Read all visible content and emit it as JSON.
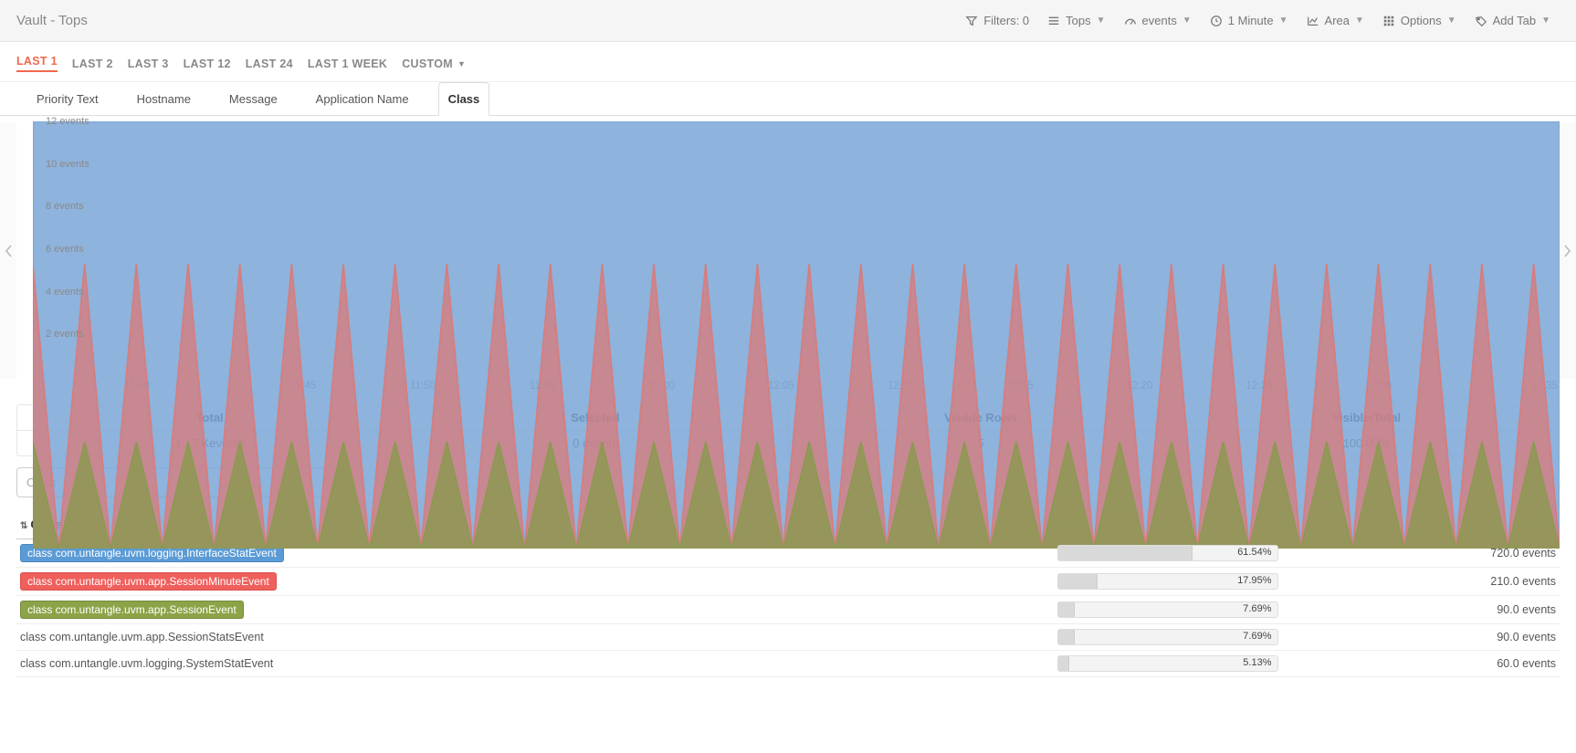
{
  "header": {
    "title": "Vault - Tops",
    "toolbar": {
      "filters": "Filters: 0",
      "tops": "Tops",
      "events": "events",
      "interval": "1 Minute",
      "chartType": "Area",
      "options": "Options",
      "addTab": "Add Tab"
    }
  },
  "ranges": {
    "items": [
      "LAST 1",
      "LAST 2",
      "LAST 3",
      "LAST 12",
      "LAST 24",
      "LAST 1 WEEK"
    ],
    "custom": "CUSTOM",
    "activeIndex": 0
  },
  "subtabs": {
    "items": [
      "Priority Text",
      "Hostname",
      "Message",
      "Application Name",
      "Class"
    ],
    "activeIndex": 4
  },
  "chart": {
    "yTicks": [
      "12 events",
      "10 events",
      "8 events",
      "6 events",
      "4 events",
      "2 events"
    ],
    "xTicks": [
      "11:40",
      "11:45",
      "11:50",
      "11:55",
      "12:00",
      "12:05",
      "12:10",
      "12:15",
      "12:20",
      "12:25",
      "12:30",
      "12:35"
    ]
  },
  "chart_data": {
    "type": "area",
    "title": "",
    "xlabel": "",
    "ylabel": "events",
    "ylim": [
      0,
      12
    ],
    "x_tick_labels": [
      "11:40",
      "11:45",
      "11:50",
      "11:55",
      "12:00",
      "12:05",
      "12:10",
      "12:15",
      "12:20",
      "12:25",
      "12:30",
      "12:35"
    ],
    "note": "Stacked area. Every minute the total reaches 12 and alternates with lower values; middle and bottom layers oscillate 0↔5 and 0↔3 respectively, producing the zig-zag pattern.",
    "series": [
      {
        "name": "class com.untangle.uvm.logging.InterfaceStatEvent",
        "color": "#7aa6d6",
        "min": 4,
        "max": 12
      },
      {
        "name": "class com.untangle.uvm.app.SessionMinuteEvent",
        "color": "#d97a7a",
        "min": 0,
        "max": 5
      },
      {
        "name": "class com.untangle.uvm.app.SessionEvent",
        "color": "#8a9a4f",
        "min": 0,
        "max": 3
      }
    ]
  },
  "summary": {
    "headers": [
      "Total",
      "Selected",
      "Visible Rows",
      "Visible/Total"
    ],
    "values": [
      "1.17 Kevents",
      "0 events",
      "5",
      "100.00%"
    ]
  },
  "filter": {
    "placeholder": "Class"
  },
  "table": {
    "headers": {
      "class": "Class",
      "pct": "%",
      "events": "events"
    },
    "rows": [
      {
        "label": "class com.untangle.uvm.logging.InterfaceStatEvent",
        "color": "blue",
        "pct": "61.54%",
        "pctNum": 61.54,
        "events": "720.0 events"
      },
      {
        "label": "class com.untangle.uvm.app.SessionMinuteEvent",
        "color": "red",
        "pct": "17.95%",
        "pctNum": 17.95,
        "events": "210.0 events"
      },
      {
        "label": "class com.untangle.uvm.app.SessionEvent",
        "color": "green",
        "pct": "7.69%",
        "pctNum": 7.69,
        "events": "90.0 events"
      },
      {
        "label": "class com.untangle.uvm.app.SessionStatsEvent",
        "color": "",
        "pct": "7.69%",
        "pctNum": 7.69,
        "events": "90.0 events"
      },
      {
        "label": "class com.untangle.uvm.logging.SystemStatEvent",
        "color": "",
        "pct": "5.13%",
        "pctNum": 5.13,
        "events": "60.0 events"
      }
    ]
  }
}
